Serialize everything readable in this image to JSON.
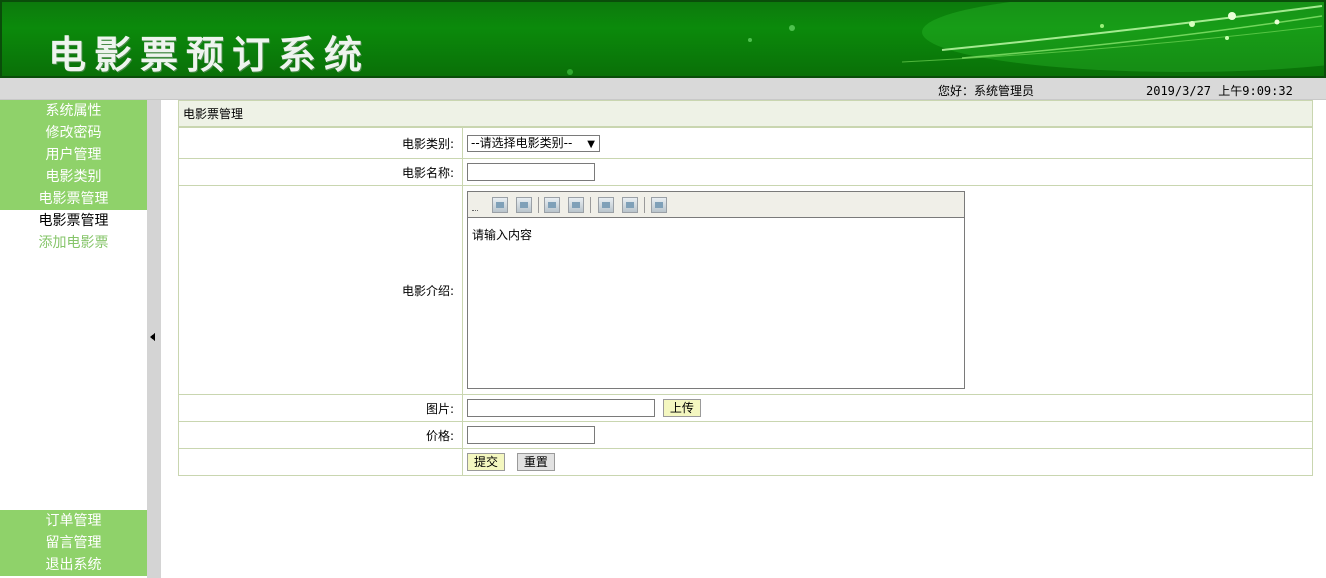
{
  "header": {
    "title": "电影票预订系统"
  },
  "status": {
    "greeting": "您好：系统管理员",
    "datetime": "2019/3/27 上午9:09:32"
  },
  "sidebar": {
    "top_items": [
      {
        "label": "系统属性"
      },
      {
        "label": "修改密码"
      },
      {
        "label": "用户管理"
      },
      {
        "label": "电影类别"
      },
      {
        "label": "电影票管理"
      },
      {
        "label": "电影票管理"
      },
      {
        "label": "添加电影票"
      }
    ],
    "bottom_items": [
      {
        "label": "订单管理"
      },
      {
        "label": "留言管理"
      },
      {
        "label": "退出系统"
      }
    ]
  },
  "form": {
    "title": "电影票管理",
    "category_label": "电影类别:",
    "category_selected": "--请选择电影类别--",
    "name_label": "电影名称:",
    "intro_label": "电影介绍:",
    "intro_placeholder": "请输入内容",
    "image_label": "图片:",
    "upload_button": "上传",
    "price_label": "价格:",
    "submit_button": "提交",
    "reset_button": "重置"
  }
}
